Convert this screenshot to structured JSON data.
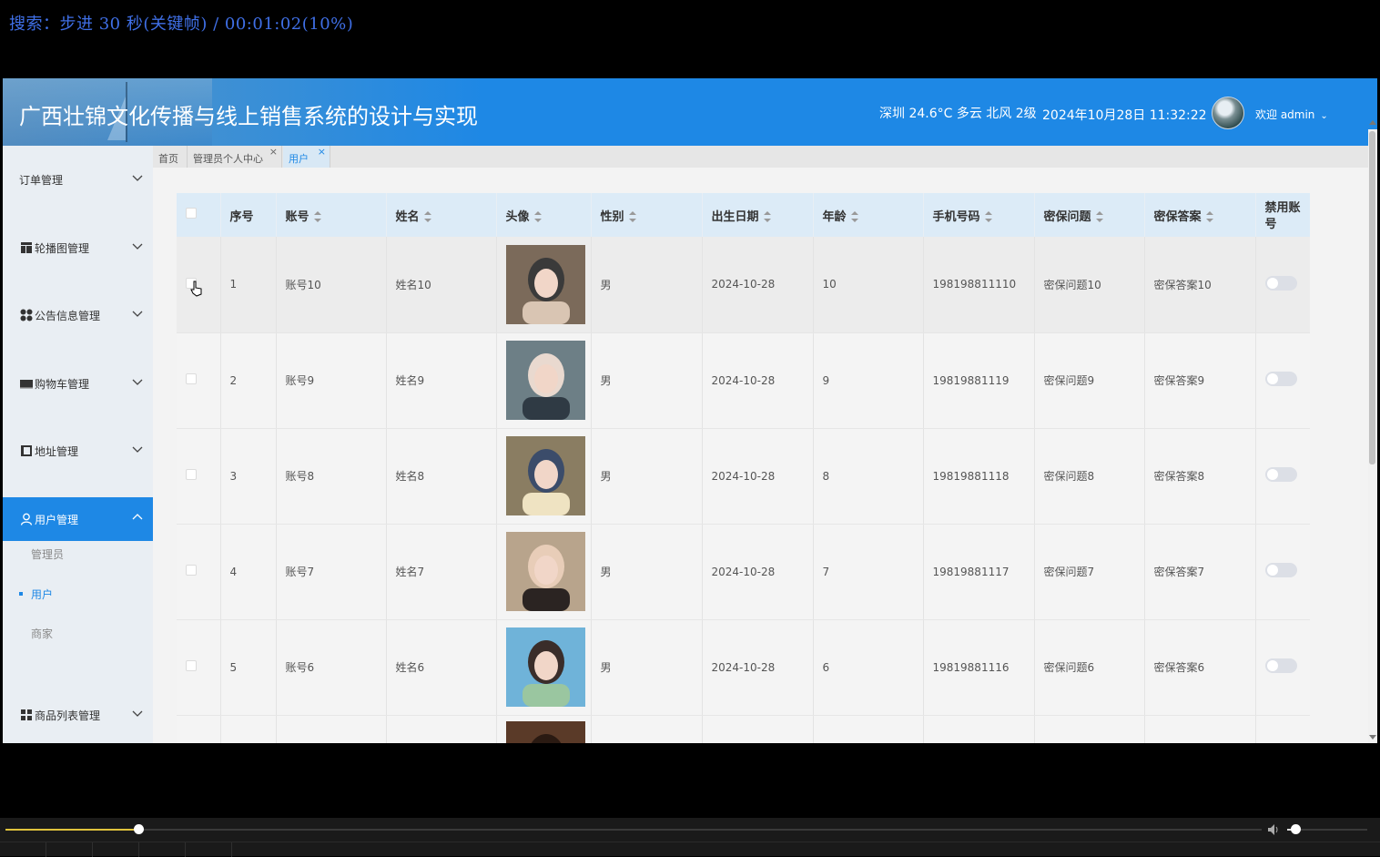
{
  "player": {
    "osd_text": "搜索：步进 30 秒(关键帧) / 00:01:02(10%)",
    "progress_fraction": 0.106,
    "volume_fraction": 0.1
  },
  "header": {
    "title": "广西壮锦文化传播与线上销售系统的设计与实现",
    "weather": "深圳 24.6°C 多云 北风 2级",
    "datetime": "2024年10月28日 11:32:22",
    "welcome": "欢迎 admin",
    "color": "#1e88e5"
  },
  "sidebar": {
    "items": [
      {
        "label": "订单管理",
        "icon": ""
      },
      {
        "label": "轮播图管理",
        "icon": "carousel-icon"
      },
      {
        "label": "公告信息管理",
        "icon": "grid-icon"
      },
      {
        "label": "购物车管理",
        "icon": "cart-icon"
      },
      {
        "label": "地址管理",
        "icon": "address-icon"
      },
      {
        "label": "用户管理",
        "icon": "user-icon"
      },
      {
        "label": "商品列表管理",
        "icon": "list-icon"
      }
    ],
    "submenu": [
      "管理员",
      "用户",
      "商家"
    ],
    "active_submenu": "用户"
  },
  "tabs": [
    {
      "label": "首页",
      "closable": false
    },
    {
      "label": "管理员个人中心",
      "closable": true
    },
    {
      "label": "用户",
      "closable": true,
      "active": true
    }
  ],
  "table": {
    "headers": [
      "序号",
      "账号",
      "姓名",
      "头像",
      "性别",
      "出生日期",
      "年龄",
      "手机号码",
      "密保问题",
      "密保答案",
      "禁用账号"
    ],
    "rows": [
      {
        "no": "1",
        "account": "账号10",
        "name": "姓名10",
        "gender": "男",
        "birth": "2024-10-28",
        "age": "10",
        "phone": "198198811110",
        "question": "密保问题10",
        "answer": "密保答案10"
      },
      {
        "no": "2",
        "account": "账号9",
        "name": "姓名9",
        "gender": "男",
        "birth": "2024-10-28",
        "age": "9",
        "phone": "19819881119",
        "question": "密保问题9",
        "answer": "密保答案9"
      },
      {
        "no": "3",
        "account": "账号8",
        "name": "姓名8",
        "gender": "男",
        "birth": "2024-10-28",
        "age": "8",
        "phone": "19819881118",
        "question": "密保问题8",
        "answer": "密保答案8"
      },
      {
        "no": "4",
        "account": "账号7",
        "name": "姓名7",
        "gender": "男",
        "birth": "2024-10-28",
        "age": "7",
        "phone": "19819881117",
        "question": "密保问题7",
        "answer": "密保答案7"
      },
      {
        "no": "5",
        "account": "账号6",
        "name": "姓名6",
        "gender": "男",
        "birth": "2024-10-28",
        "age": "6",
        "phone": "19819881116",
        "question": "密保问题6",
        "answer": "密保答案6"
      }
    ]
  }
}
